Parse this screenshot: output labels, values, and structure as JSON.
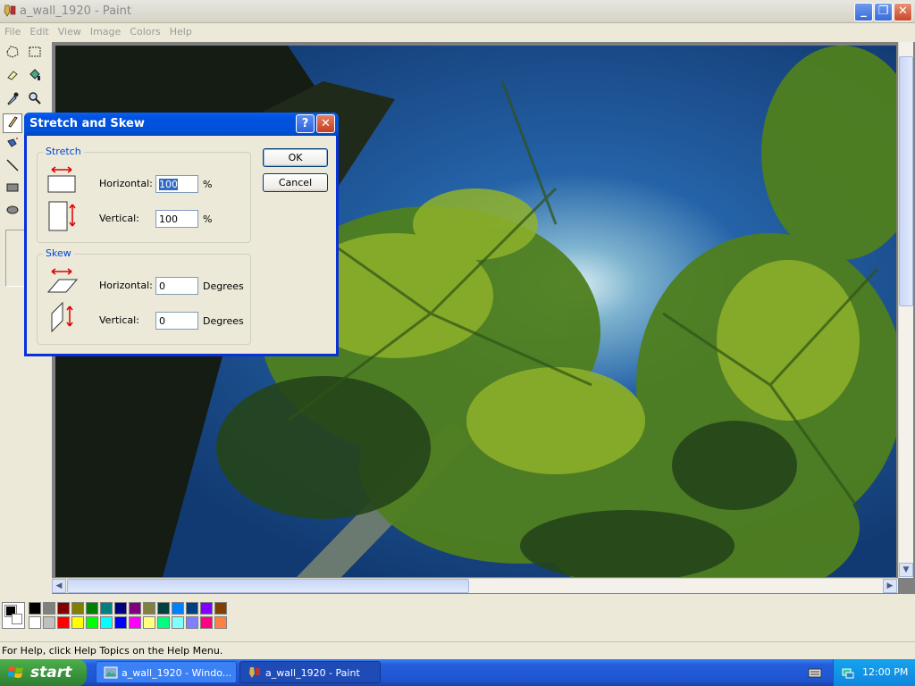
{
  "window": {
    "title": "a_wall_1920 - Paint",
    "minimize": "_",
    "maximize": "❐",
    "close": "✕"
  },
  "menu": [
    "File",
    "Edit",
    "View",
    "Image",
    "Colors",
    "Help"
  ],
  "tools": [
    "free-form-select",
    "select",
    "eraser",
    "fill-with-color",
    "pick-color",
    "magnifier",
    "pencil",
    "brush",
    "airbrush",
    "text",
    "line",
    "curve",
    "rectangle",
    "polygon",
    "ellipse",
    "rounded-rectangle"
  ],
  "dialog": {
    "title": "Stretch and Skew",
    "help": "?",
    "close": "✕",
    "stretch": {
      "legend": "Stretch",
      "horizontal_label": "Horizontal:",
      "horizontal_value": "100",
      "horizontal_unit": "%",
      "vertical_label": "Vertical:",
      "vertical_value": "100",
      "vertical_unit": "%"
    },
    "skew": {
      "legend": "Skew",
      "horizontal_label": "Horizontal:",
      "horizontal_value": "0",
      "horizontal_unit": "Degrees",
      "vertical_label": "Vertical:",
      "vertical_value": "0",
      "vertical_unit": "Degrees"
    },
    "ok": "OK",
    "cancel": "Cancel"
  },
  "palette": {
    "foreground": "#000000",
    "background": "#ffffff",
    "top_row": [
      "#000000",
      "#808080",
      "#800000",
      "#808000",
      "#008000",
      "#008080",
      "#000080",
      "#800080",
      "#808040",
      "#004040",
      "#0080ff",
      "#004080",
      "#8000ff",
      "#804000"
    ],
    "bottom_row": [
      "#ffffff",
      "#c0c0c0",
      "#ff0000",
      "#ffff00",
      "#00ff00",
      "#00ffff",
      "#0000ff",
      "#ff00ff",
      "#ffff80",
      "#00ff80",
      "#80ffff",
      "#8080ff",
      "#ff0080",
      "#ff8040"
    ]
  },
  "status": {
    "text": "For Help, click Help Topics on the Help Menu."
  },
  "taskbar": {
    "start": "start",
    "tasks": [
      {
        "label": "a_wall_1920 - Windo...",
        "active": false
      },
      {
        "label": "a_wall_1920 - Paint",
        "active": true
      }
    ],
    "clock": "12:00 PM"
  }
}
